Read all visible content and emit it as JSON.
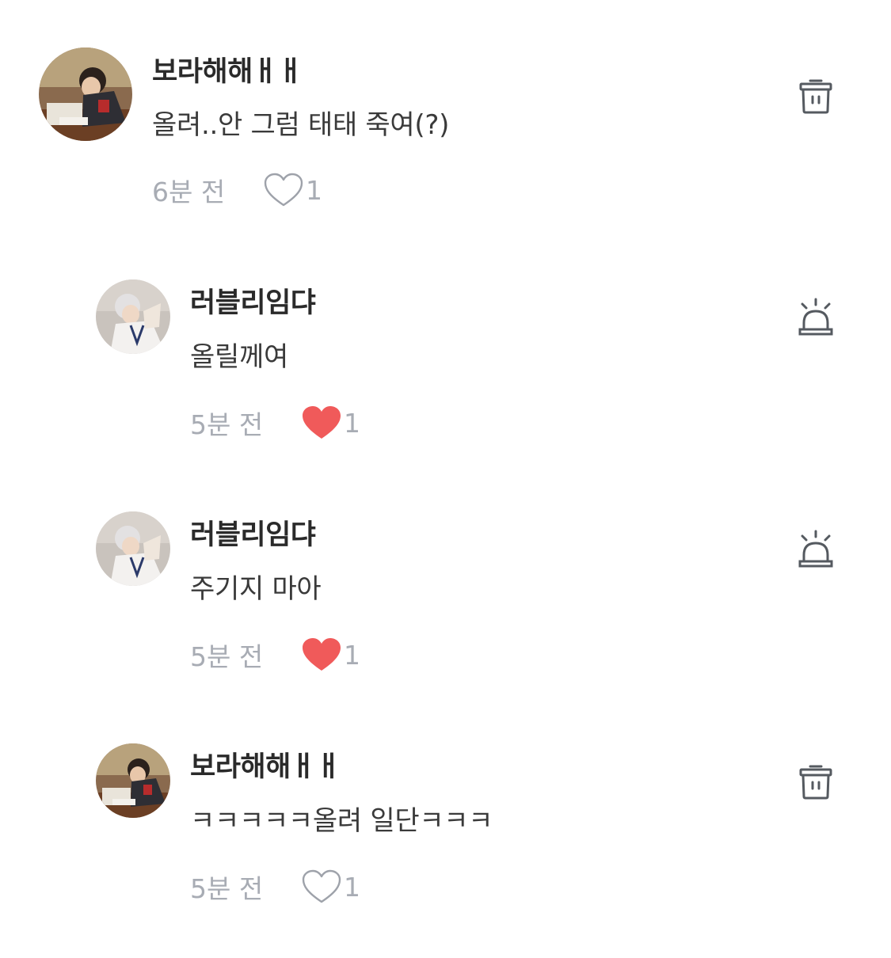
{
  "comments": [
    {
      "username": "보라해해ㅐㅐ",
      "text": "올려..안 그럼 태태 죽여(?)",
      "time": "6분 전",
      "likes": "1",
      "liked": false,
      "action": "trash-icon",
      "reply": false
    },
    {
      "username": "러블리임댜",
      "text": "올릴께여",
      "time": "5분 전",
      "likes": "1",
      "liked": true,
      "action": "report-siren-icon",
      "reply": true
    },
    {
      "username": "러블리임댜",
      "text": "주기지 마아",
      "time": "5분 전",
      "likes": "1",
      "liked": true,
      "action": "report-siren-icon",
      "reply": true
    },
    {
      "username": "보라해해ㅐㅐ",
      "text": "ㅋㅋㅋㅋㅋ올려 일단ㅋㅋㅋ",
      "time": "5분 전",
      "likes": "1",
      "liked": false,
      "action": "trash-icon",
      "reply": true
    }
  ],
  "colors": {
    "like_active": "#f05a5a",
    "like_inactive": "#9ea2aa",
    "meta_text": "#a8acb4",
    "icon": "#555a60"
  }
}
